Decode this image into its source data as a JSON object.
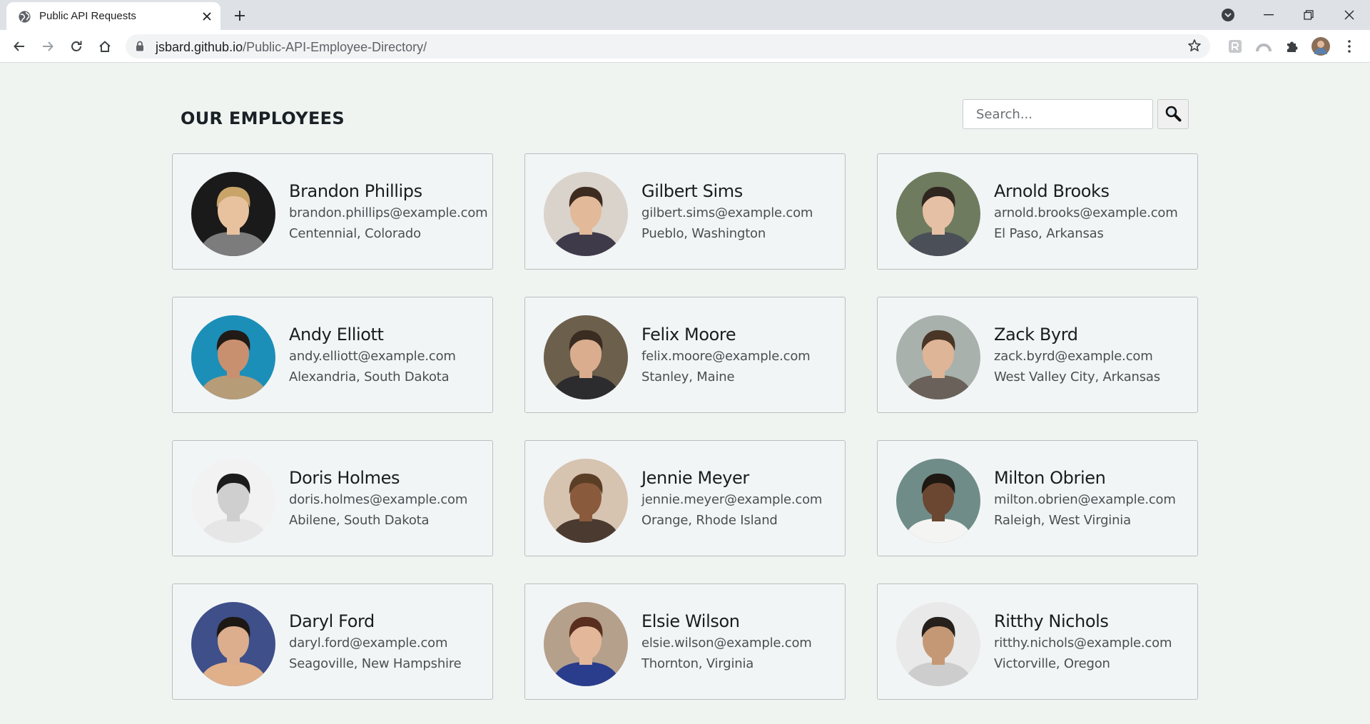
{
  "browser": {
    "tab_title": "Public API Requests",
    "url_host": "jsbard.github.io",
    "url_path": "/Public-API-Employee-Directory/"
  },
  "page": {
    "title": "OUR EMPLOYEES",
    "search": {
      "placeholder": "Search...",
      "value": ""
    }
  },
  "employees": [
    {
      "name": "Brandon Phillips",
      "email": "brandon.phillips@example.com",
      "location": "Centennial, Colorado",
      "photo": {
        "bg": "#1a1a1a",
        "skin": "#e8c29f",
        "hair": "#c9a468",
        "shirt": "#7c7c7c"
      }
    },
    {
      "name": "Gilbert Sims",
      "email": "gilbert.sims@example.com",
      "location": "Pueblo, Washington",
      "photo": {
        "bg": "#d9d3cc",
        "skin": "#e2b999",
        "hair": "#3d2b1f",
        "shirt": "#3f3a4a"
      }
    },
    {
      "name": "Arnold Brooks",
      "email": "arnold.brooks@example.com",
      "location": "El Paso, Arkansas",
      "photo": {
        "bg": "#6e7b5e",
        "skin": "#e6c0a4",
        "hair": "#2f2620",
        "shirt": "#4a4f58"
      }
    },
    {
      "name": "Andy Elliott",
      "email": "andy.elliott@example.com",
      "location": "Alexandria, South Dakota",
      "photo": {
        "bg": "#1b8fb8",
        "skin": "#c99070",
        "hair": "#221a16",
        "shirt": "#b79c78"
      }
    },
    {
      "name": "Felix Moore",
      "email": "felix.moore@example.com",
      "location": "Stanley, Maine",
      "photo": {
        "bg": "#6c5f4c",
        "skin": "#d9ad8e",
        "hair": "#3a2c21",
        "shirt": "#2c2c2e"
      }
    },
    {
      "name": "Zack Byrd",
      "email": "zack.byrd@example.com",
      "location": "West Valley City, Arkansas",
      "photo": {
        "bg": "#a9b1ad",
        "skin": "#dfb597",
        "hair": "#4a3626",
        "shirt": "#6a625a"
      }
    },
    {
      "name": "Doris Holmes",
      "email": "doris.holmes@example.com",
      "location": "Abilene, South Dakota",
      "photo": {
        "bg": "#f2f2f2",
        "skin": "#cfcfcf",
        "hair": "#1b1b1b",
        "shirt": "#e6e6e6"
      }
    },
    {
      "name": "Jennie Meyer",
      "email": "jennie.meyer@example.com",
      "location": "Orange, Rhode Island",
      "photo": {
        "bg": "#d6c3b0",
        "skin": "#8a5a3c",
        "hair": "#5b3e26",
        "shirt": "#4a3a30"
      }
    },
    {
      "name": "Milton Obrien",
      "email": "milton.obrien@example.com",
      "location": "Raleigh, West Virginia",
      "photo": {
        "bg": "#6f8c88",
        "skin": "#6b4630",
        "hair": "#1f1712",
        "shirt": "#f4f4f2"
      }
    },
    {
      "name": "Daryl Ford",
      "email": "daryl.ford@example.com",
      "location": "Seagoville, New Hampshire",
      "photo": {
        "bg": "#3e4f8a",
        "skin": "#dcae8d",
        "hair": "#1e1814",
        "shirt": "#e0b08a"
      }
    },
    {
      "name": "Elsie Wilson",
      "email": "elsie.wilson@example.com",
      "location": "Thornton, Virginia",
      "photo": {
        "bg": "#b5a08c",
        "skin": "#e3b89a",
        "hair": "#5a2e1e",
        "shirt": "#2a3d8c"
      }
    },
    {
      "name": "Ritthy Nichols",
      "email": "ritthy.nichols@example.com",
      "location": "Victorville, Oregon",
      "photo": {
        "bg": "#e9e9e9",
        "skin": "#c59875",
        "hair": "#26201c",
        "shirt": "#cdcdcd"
      }
    }
  ]
}
